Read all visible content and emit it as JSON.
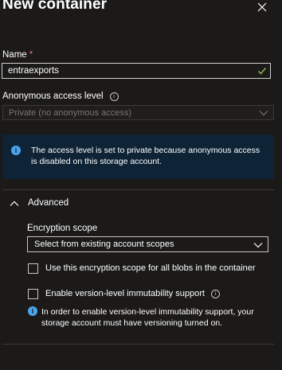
{
  "panel": {
    "title": "New container"
  },
  "name_field": {
    "label": "Name",
    "required_marker": "*",
    "value": "entraexports"
  },
  "access_level": {
    "label": "Anonymous access level",
    "info_glyph": "i",
    "selected": "Private (no anonymous access)"
  },
  "info_bar": {
    "icon_glyph": "i",
    "message": "The access level is set to private because anonymous access is disabled on this storage account."
  },
  "advanced": {
    "label": "Advanced",
    "encryption_scope": {
      "label": "Encryption scope",
      "selected": "Select from existing account scopes"
    },
    "use_scope_checkbox": {
      "label": "Use this encryption scope for all blobs in the container",
      "checked": false
    },
    "immutability_checkbox": {
      "label": "Enable version-level immutability support",
      "info_glyph": "i",
      "checked": false
    },
    "note": {
      "icon_glyph": "i",
      "text": "In order to enable version-level immutability support, your storage account must have versioning turned on."
    }
  },
  "colors": {
    "background": "#1b1a19",
    "info_bar_background": "#0f2336",
    "accent_blue": "#4aa5ef",
    "required_red": "#f1707b",
    "valid_check_green": "#92c353"
  }
}
